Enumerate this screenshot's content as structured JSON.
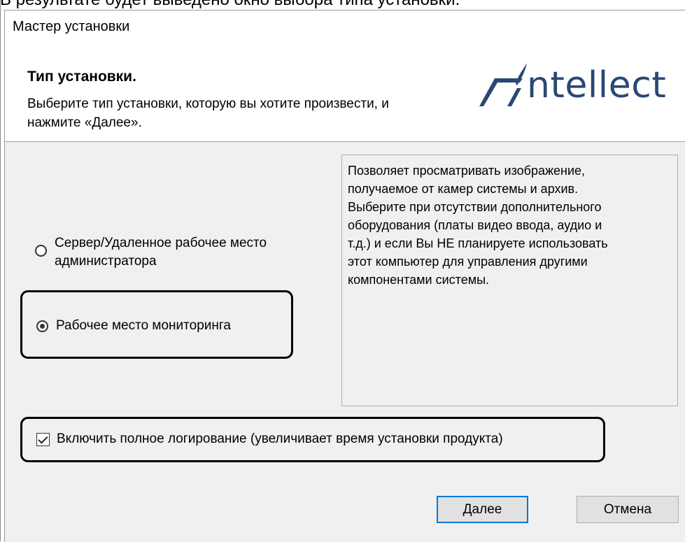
{
  "caption": "В результате будет выведено окно выбора типа установки.",
  "window": {
    "title": "Мастер установки"
  },
  "header": {
    "title": "Тип установки.",
    "subtitle": "Выберите тип установки, которую вы хотите произвести, и нажмите «Далее».",
    "logo_text": "ntellect",
    "brand_color": "#2b4874"
  },
  "options": [
    {
      "label": "Сервер/Удаленное рабочее место администратора",
      "selected": false
    },
    {
      "label": "Рабочее место мониторинга",
      "selected": true
    }
  ],
  "description": "Позволяет просматривать изображение,\nполучаемое от камер системы и архив.\nВыберите при отсутствии дополнительного\nоборудования (платы видео ввода, аудио и\nт.д.) и если Вы НЕ планируете использовать\n этот компьютер для управления другими\nкомпонентами системы.",
  "logging": {
    "label": "Включить полное логирование (увеличивает время установки продукта)",
    "checked": true
  },
  "buttons": {
    "next": "Далее",
    "cancel": "Отмена"
  }
}
